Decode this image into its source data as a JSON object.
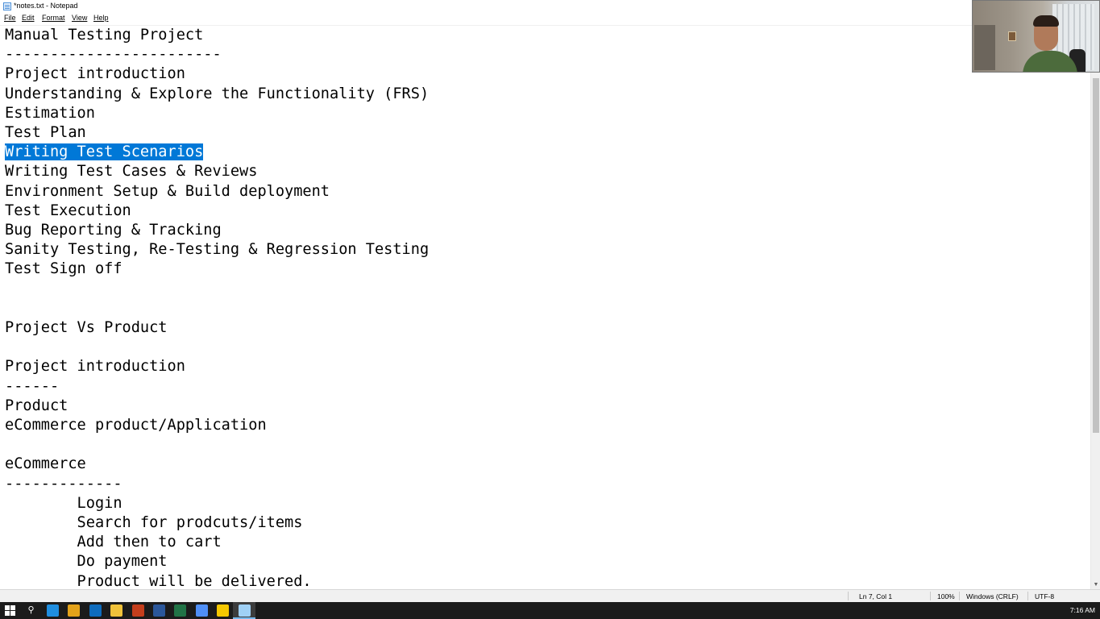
{
  "window": {
    "title": "*notes.txt - Notepad"
  },
  "menu": {
    "file": "File",
    "edit": "Edit",
    "format": "Format",
    "view": "View",
    "help": "Help"
  },
  "editor": {
    "lines": [
      "Manual Testing Project",
      "------------------------",
      "Project introduction",
      "Understanding & Explore the Functionality (FRS)",
      "Estimation",
      "Test Plan",
      "Writing Test Scenarios",
      "Writing Test Cases & Reviews",
      "Environment Setup & Build deployment",
      "Test Execution",
      "Bug Reporting & Tracking",
      "Sanity Testing, Re-Testing & Regression Testing",
      "Test Sign off",
      "",
      "",
      "Project Vs Product",
      "",
      "Project introduction",
      "------",
      "Product",
      "eCommerce product/Application",
      "",
      "eCommerce",
      "-------------",
      "        Login",
      "        Search for prodcuts/items",
      "        Add then to cart",
      "        Do payment",
      "        Product will be delivered."
    ],
    "selected_line_index": 6
  },
  "status": {
    "position": "Ln 7, Col 1",
    "zoom": "100%",
    "line_ending": "Windows (CRLF)",
    "encoding": "UTF-8"
  },
  "taskbar": {
    "clock": "7:16 AM",
    "apps": [
      {
        "icon": "edge-icon",
        "color": "#1f8ee0"
      },
      {
        "icon": "chrome-icon",
        "color": "#e3a21a"
      },
      {
        "icon": "outlook-icon",
        "color": "#0f6cbd"
      },
      {
        "icon": "file-explorer-icon",
        "color": "#f0c23a"
      },
      {
        "icon": "powerpoint-icon",
        "color": "#c43e1c"
      },
      {
        "icon": "word-icon",
        "color": "#2b579a"
      },
      {
        "icon": "excel-icon",
        "color": "#217346"
      },
      {
        "icon": "webcam-app-icon",
        "color": "#4f8ff7"
      },
      {
        "icon": "sticky-notes-icon",
        "color": "#f6c800"
      },
      {
        "icon": "notepad-icon",
        "color": "#9fd0f5"
      }
    ]
  },
  "colors": {
    "selection": "#0078d7",
    "taskbar": "#1b1b1b",
    "statusbar": "#f0f0f0"
  }
}
